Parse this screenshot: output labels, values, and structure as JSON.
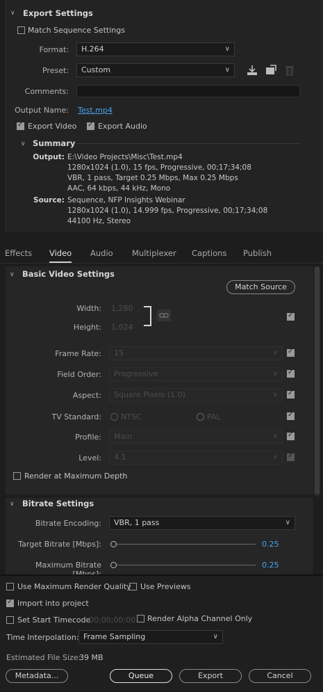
{
  "export_settings": {
    "title": "Export Settings",
    "match_sequence_label": "Match Sequence Settings",
    "match_sequence_checked": false,
    "format_label": "Format:",
    "format_value": "H.264",
    "preset_label": "Preset:",
    "preset_value": "Custom",
    "comments_label": "Comments:",
    "comments_value": "",
    "output_name_label": "Output Name:",
    "output_name_value": "Test.mp4",
    "export_video_label": "Export Video",
    "export_video_checked": true,
    "export_audio_label": "Export Audio",
    "export_audio_checked": true,
    "summary": {
      "title": "Summary",
      "output_label": "Output:",
      "output_lines": [
        "E:\\Video Projects\\Misc\\Test.mp4",
        "1280x1024 (1.0), 15 fps, Progressive, 00;17;34;08",
        "VBR, 1 pass, Target 0.25 Mbps, Max 0.25 Mbps",
        "AAC, 64 kbps, 44 kHz, Mono"
      ],
      "source_label": "Source:",
      "source_lines": [
        "Sequence, NFP Insights Webinar",
        "1280x1024 (1.0), 14.999 fps, Progressive, 00;17;34;08",
        "44100 Hz, Stereo"
      ]
    }
  },
  "tabs": [
    "Effects",
    "Video",
    "Audio",
    "Multiplexer",
    "Captions",
    "Publish"
  ],
  "active_tab": "Video",
  "basic_video": {
    "title": "Basic Video Settings",
    "match_source_label": "Match Source",
    "width_label": "Width:",
    "width_value": "1,280",
    "height_label": "Height:",
    "height_value": "1,024",
    "frame_rate_label": "Frame Rate:",
    "frame_rate_value": "15",
    "field_order_label": "Field Order:",
    "field_order_value": "Progressive",
    "aspect_label": "Aspect:",
    "aspect_value": "Square Pixels (1.0)",
    "tv_standard_label": "TV Standard:",
    "ntsc_label": "NTSC",
    "pal_label": "PAL",
    "profile_label": "Profile:",
    "profile_value": "Main",
    "level_label": "Level:",
    "level_value": "4.1",
    "render_max_depth_label": "Render at Maximum Depth"
  },
  "bitrate": {
    "title": "Bitrate Settings",
    "encoding_label": "Bitrate Encoding:",
    "encoding_value": "VBR, 1 pass",
    "target_label": "Target Bitrate [Mbps]:",
    "target_value": "0.25",
    "max_label": "Maximum Bitrate [Mbps]:",
    "max_value": "0.25"
  },
  "footer": {
    "use_max_render_label": "Use Maximum Render Quality",
    "use_previews_label": "Use Previews",
    "import_project_label": "Import into project",
    "set_start_timecode_label": "Set Start Timecode",
    "timecode_value": "00;00;00;00",
    "render_alpha_label": "Render Alpha Channel Only",
    "time_interp_label": "Time Interpolation:",
    "time_interp_value": "Frame Sampling",
    "file_size_label": "Estimated File Size:",
    "file_size_value": "39 MB",
    "metadata_label": "Metadata...",
    "queue_label": "Queue",
    "export_label": "Export",
    "cancel_label": "Cancel"
  },
  "colors": {
    "accent_link": "#4ba3ea",
    "panel_bg": "#262626",
    "page_bg": "#1d1d1d"
  }
}
